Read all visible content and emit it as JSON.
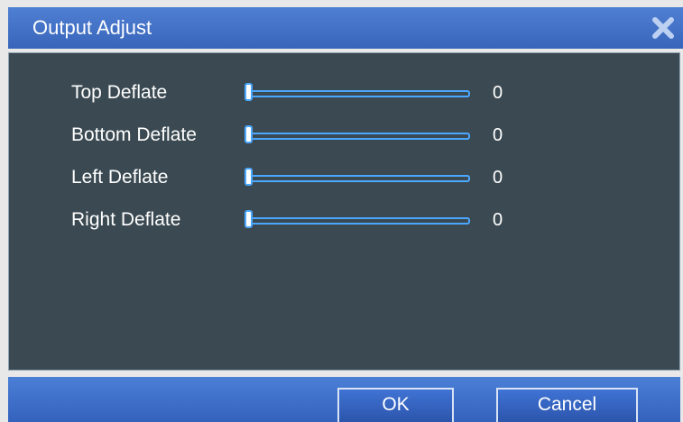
{
  "window": {
    "title": "Output Adjust",
    "close_icon": "close-icon"
  },
  "sliders": [
    {
      "label": "Top Deflate",
      "value": "0",
      "level": 0
    },
    {
      "label": "Bottom Deflate",
      "value": "0",
      "level": 0
    },
    {
      "label": "Left Deflate",
      "value": "0",
      "level": 0
    },
    {
      "label": "Right Deflate",
      "value": "0",
      "level": 0
    }
  ],
  "buttons": {
    "ok_label": "OK",
    "cancel_label": "Cancel"
  },
  "colors": {
    "title_bar": "#3f6fc6",
    "panel_bg": "#3b4a52",
    "slider_accent": "#4ca7ff",
    "footer_bar": "#3f6fc9"
  }
}
